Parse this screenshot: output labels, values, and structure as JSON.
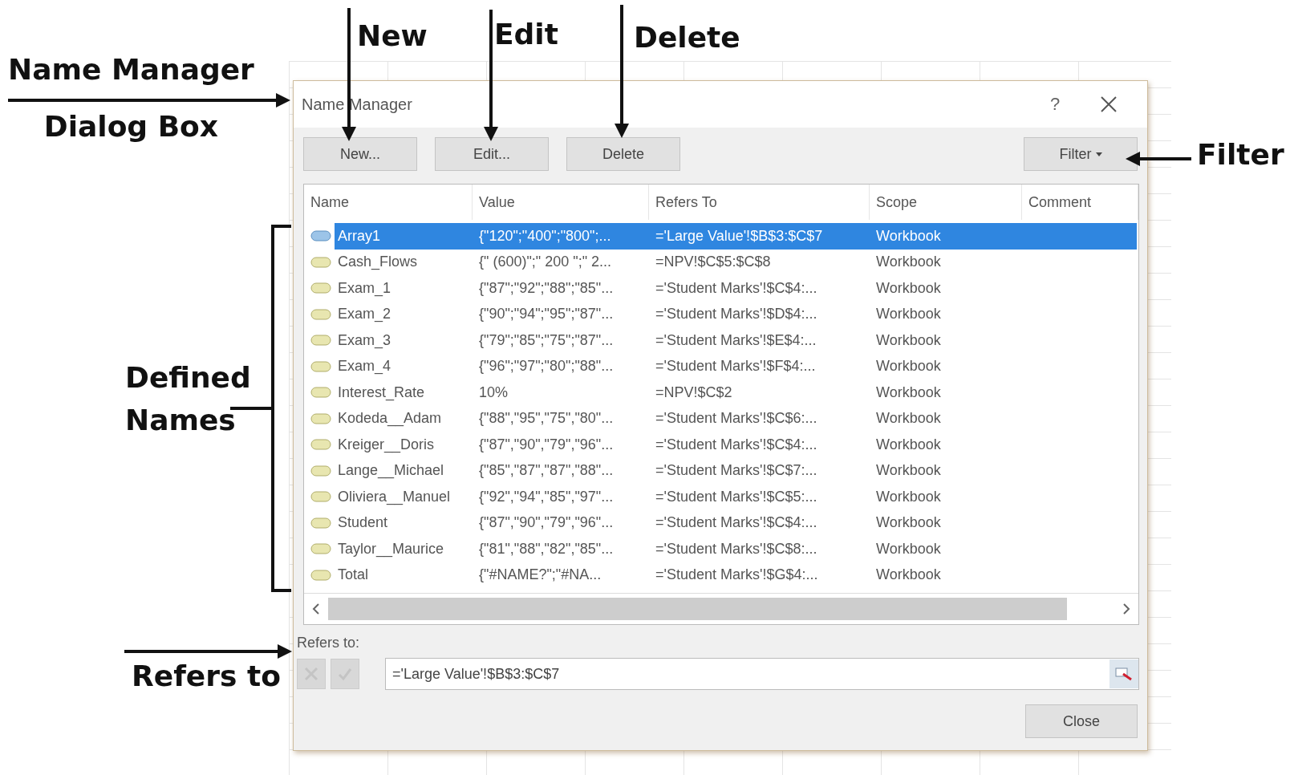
{
  "annotations": [
    {
      "lines": [
        "New"
      ],
      "kind": "down-arrow"
    },
    {
      "lines": [
        "Edit"
      ],
      "kind": "down-arrow"
    },
    {
      "lines": [
        "Delete"
      ],
      "kind": "down-arrow"
    },
    {
      "lines": [
        "Name Manager",
        "Dialog Box"
      ],
      "kind": "right-arrow"
    },
    {
      "lines": [
        "Filter"
      ],
      "kind": "left-arrow"
    },
    {
      "lines": [
        "Defined",
        "Names"
      ],
      "kind": "bracket"
    },
    {
      "lines": [
        "Refers to"
      ],
      "kind": "right-arrow"
    }
  ],
  "dialog": {
    "title": "Name Manager",
    "help": "?",
    "toolbar": [
      {
        "label": "New..."
      },
      {
        "label": "Edit..."
      },
      {
        "label": "Delete"
      }
    ],
    "filter": "Filter",
    "table": {
      "columns": [
        "Name",
        "Value",
        "Refers To",
        "Scope",
        "Comment"
      ],
      "rows": [
        {
          "name": "Array1",
          "value": "{\"120\";\"400\";\"800\";...",
          "refers_to": "='Large Value'!$B$3:$C$7",
          "scope": "Workbook",
          "selected": true
        },
        {
          "name": "Cash_Flows",
          "value": "{\" (600)\";\" 200 \";\" 2...",
          "refers_to": "=NPV!$C$5:$C$8",
          "scope": "Workbook",
          "selected": false
        },
        {
          "name": "Exam_1",
          "value": "{\"87\";\"92\";\"88\";\"85\"...",
          "refers_to": "='Student Marks'!$C$4:...",
          "scope": "Workbook",
          "selected": false
        },
        {
          "name": "Exam_2",
          "value": "{\"90\";\"94\";\"95\";\"87\"...",
          "refers_to": "='Student Marks'!$D$4:...",
          "scope": "Workbook",
          "selected": false
        },
        {
          "name": "Exam_3",
          "value": "{\"79\";\"85\";\"75\";\"87\"...",
          "refers_to": "='Student Marks'!$E$4:...",
          "scope": "Workbook",
          "selected": false
        },
        {
          "name": "Exam_4",
          "value": "{\"96\";\"97\";\"80\";\"88\"...",
          "refers_to": "='Student Marks'!$F$4:...",
          "scope": "Workbook",
          "selected": false
        },
        {
          "name": "Interest_Rate",
          "value": "10%",
          "refers_to": "=NPV!$C$2",
          "scope": "Workbook",
          "selected": false
        },
        {
          "name": "Kodeda__Adam",
          "value": "{\"88\",\"95\",\"75\",\"80\"...",
          "refers_to": "='Student Marks'!$C$6:...",
          "scope": "Workbook",
          "selected": false
        },
        {
          "name": "Kreiger__Doris",
          "value": "{\"87\",\"90\",\"79\",\"96\"...",
          "refers_to": "='Student Marks'!$C$4:...",
          "scope": "Workbook",
          "selected": false
        },
        {
          "name": "Lange__Michael",
          "value": "{\"85\",\"87\",\"87\",\"88\"...",
          "refers_to": "='Student Marks'!$C$7:...",
          "scope": "Workbook",
          "selected": false
        },
        {
          "name": "Oliviera__Manuel",
          "value": "{\"92\",\"94\",\"85\",\"97\"...",
          "refers_to": "='Student Marks'!$C$5:...",
          "scope": "Workbook",
          "selected": false
        },
        {
          "name": "Student",
          "value": "{\"87\",\"90\",\"79\",\"96\"...",
          "refers_to": "='Student Marks'!$C$4:...",
          "scope": "Workbook",
          "selected": false
        },
        {
          "name": "Taylor__Maurice",
          "value": "{\"81\",\"88\",\"82\",\"85\"...",
          "refers_to": "='Student Marks'!$C$8:...",
          "scope": "Workbook",
          "selected": false
        },
        {
          "name": "Total",
          "value": "{\"#NAME?\";\"#NA...",
          "refers_to": "='Student Marks'!$G$4:...",
          "scope": "Workbook",
          "selected": false
        }
      ]
    },
    "refers_to": {
      "label": "Refers to:",
      "value": "='Large Value'!$B$3:$C$7"
    },
    "close": "Close"
  }
}
